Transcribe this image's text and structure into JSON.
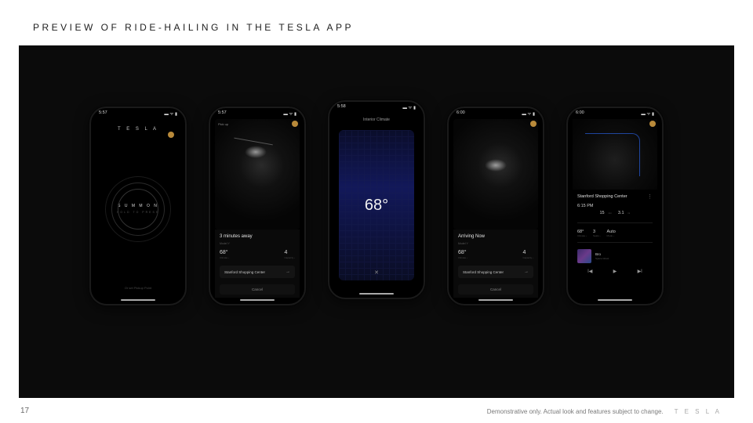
{
  "slide": {
    "title": "PREVIEW OF RIDE-HAILING IN THE TESLA APP",
    "page_number": "17",
    "footer_disclaimer": "Demonstrative only. Actual look and features subject to change.",
    "footer_logo": "T E S L A"
  },
  "phones": {
    "p1": {
      "time": "5:57",
      "brand": "T E S L A",
      "main_label": "S U M M O N",
      "sub_label": "HOLD TO PRESS",
      "bottom_hint": "Or set Pickup Point"
    },
    "p2": {
      "time": "5:57",
      "pickup_label": "Pick up",
      "status_title": "3 minutes away",
      "status_sub": "Model Y",
      "temp_val": "68°",
      "temp_lbl": "Climate ›",
      "seats_val": "4",
      "seats_lbl": "Capacity ›",
      "dest": "Stanford Shopping Center",
      "cancel": "Cancel"
    },
    "p3": {
      "time": "5:58",
      "title": "Interior Climate",
      "temp": "68°",
      "close": "✕"
    },
    "p4": {
      "time": "6:00",
      "status_title": "Arriving Now",
      "status_sub": "Model Y",
      "temp_val": "68°",
      "temp_lbl": "Climate ›",
      "seats_val": "4",
      "seats_lbl": "Capacity ›",
      "dest": "Stanford Shopping Center",
      "cancel": "Cancel"
    },
    "p5": {
      "time": "6:00",
      "dest": "Stanford Shopping Center",
      "eta_val": "6:15 PM",
      "eta_lbl": "",
      "dur_val": "15",
      "dur_unit": "min",
      "dist_val": "3.1",
      "dist_unit": "mi",
      "temp_val": "68°",
      "temp_lbl": "Climate ›",
      "seats_val": "3",
      "seats_lbl": "Seats ›",
      "ride_val": "Auto",
      "ride_lbl": "Mode ›",
      "track": "Bro",
      "artist": "Space Ghost",
      "ctrl_prev": "I◀",
      "ctrl_play": "▶I",
      "ctrl_next": "▶I"
    }
  }
}
